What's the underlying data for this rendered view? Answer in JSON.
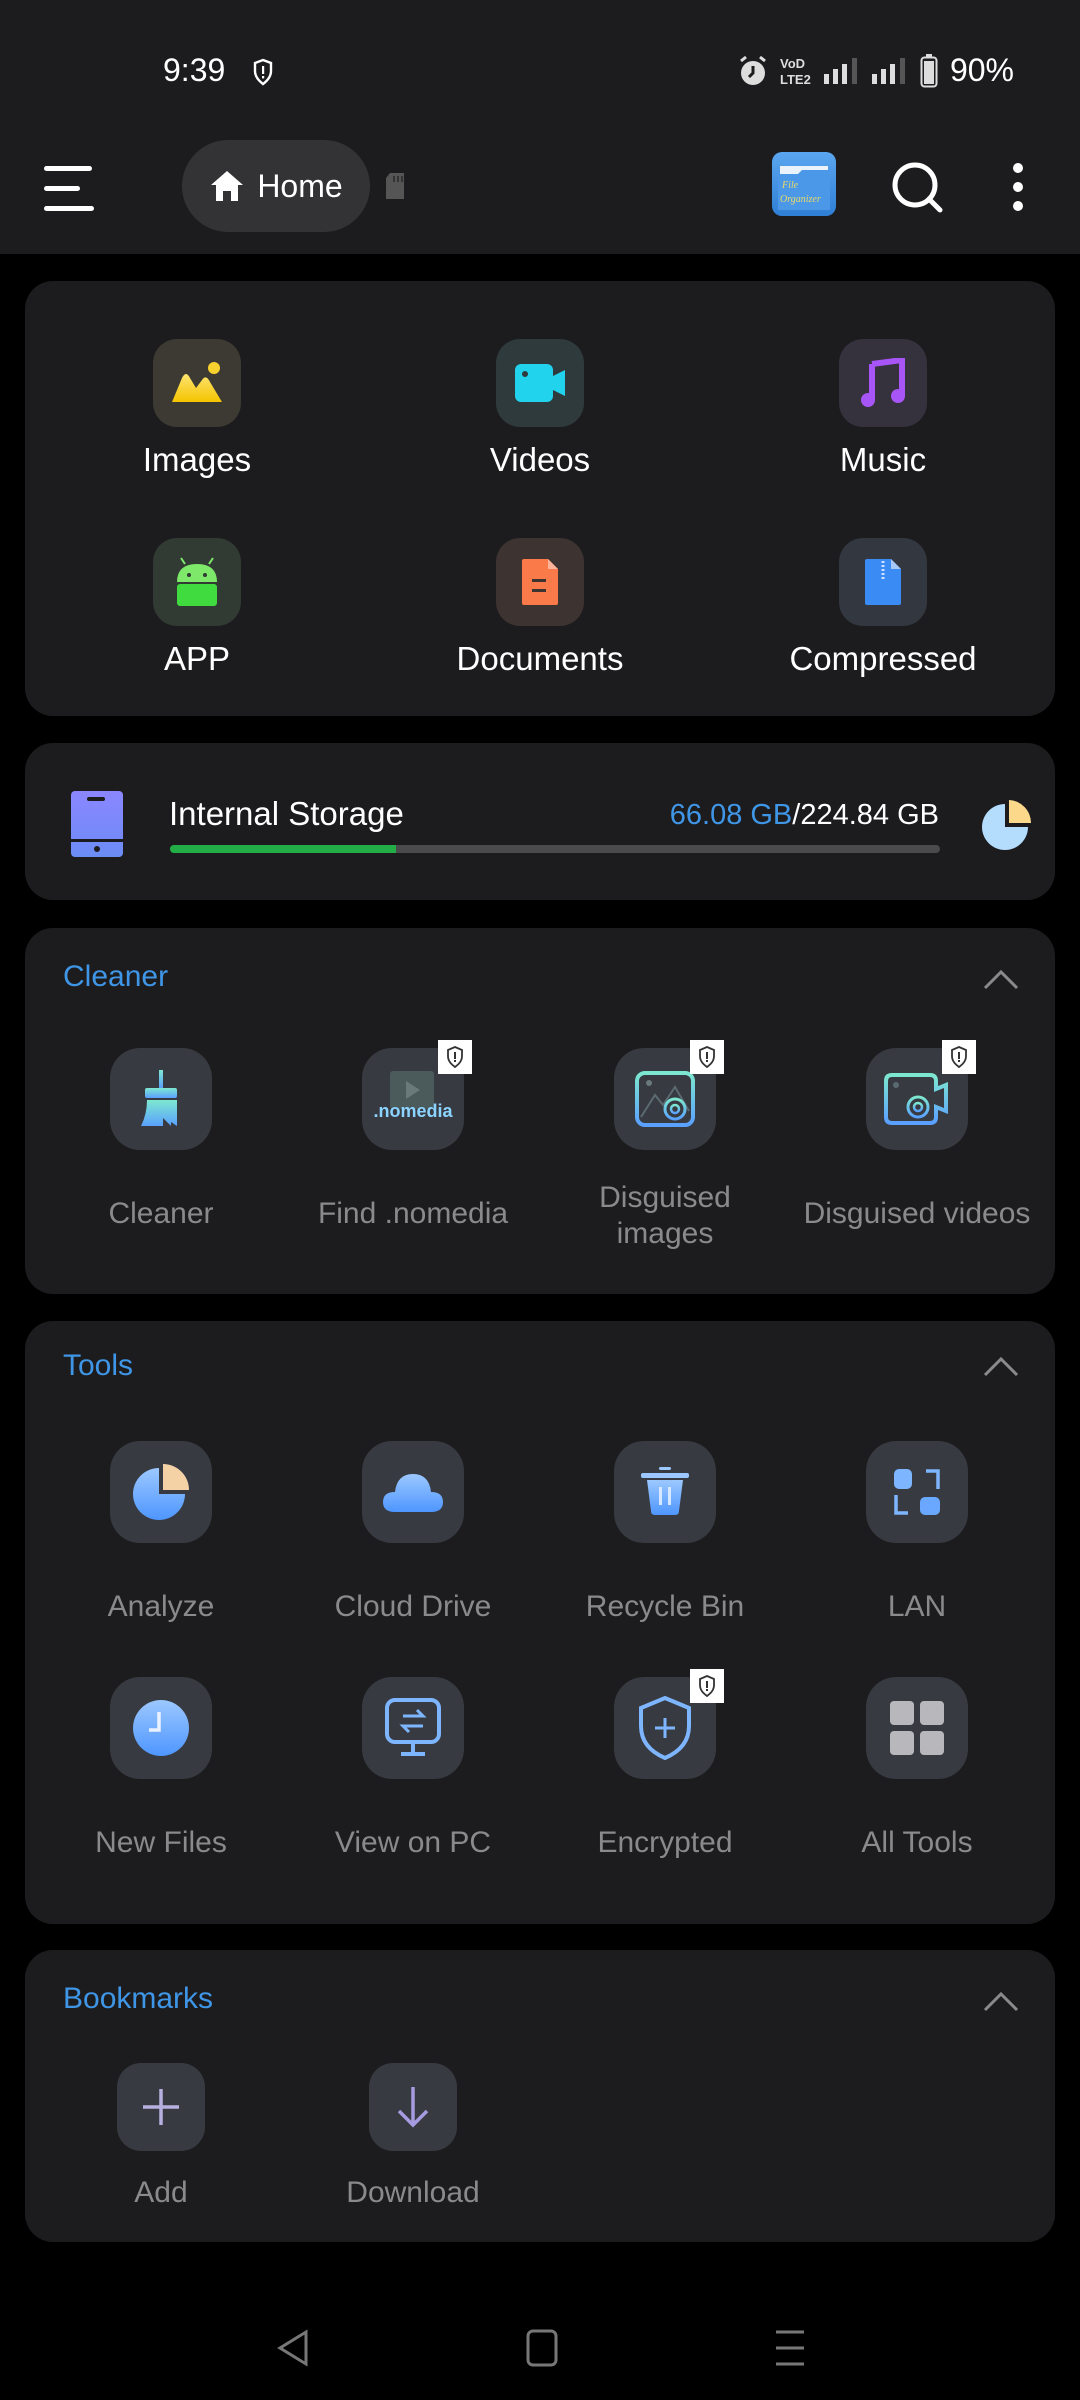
{
  "status_bar": {
    "time": "9:39",
    "battery": "90%",
    "icons": [
      "shield-alert-icon",
      "alarm-icon",
      "volte-icon",
      "signal-icon",
      "signal-icon",
      "battery-icon"
    ]
  },
  "app_bar": {
    "breadcrumb_home": "Home",
    "logo_text_line1": "File",
    "logo_text_line2": "Organizer"
  },
  "categories": [
    {
      "label": "Images",
      "icon": "image-icon",
      "color": "#f7d22e",
      "tile": "#3c3a32"
    },
    {
      "label": "Videos",
      "icon": "video-camera-icon",
      "color": "#22d3ee",
      "tile": "#2f3a3c"
    },
    {
      "label": "Music",
      "icon": "music-note-icon",
      "color": "#a855f7",
      "tile": "#35313d"
    },
    {
      "label": "APP",
      "icon": "android-icon",
      "color": "#4ade5a",
      "tile": "#313a33"
    },
    {
      "label": "Documents",
      "icon": "document-icon",
      "color": "#fb7a4a",
      "tile": "#3d3331"
    },
    {
      "label": "Compressed",
      "icon": "zip-file-icon",
      "color": "#3b8bf5",
      "tile": "#323740"
    }
  ],
  "storage": {
    "title": "Internal Storage",
    "used": "66.08 GB",
    "separator": "/",
    "total": "224.84 GB",
    "used_fraction": 0.294
  },
  "cleaner": {
    "title": "Cleaner",
    "items": [
      {
        "label": "Cleaner",
        "icon": "broom-icon",
        "badge": false
      },
      {
        "label": "Find .nomedia",
        "icon": "nomedia-icon",
        "badge": true,
        "icon_text": ".nomedia"
      },
      {
        "label": "Disguised images",
        "icon": "disguised-image-icon",
        "badge": true
      },
      {
        "label": "Disguised videos",
        "icon": "disguised-video-icon",
        "badge": true
      }
    ]
  },
  "tools": {
    "title": "Tools",
    "items": [
      {
        "label": "Analyze",
        "icon": "pie-chart-icon",
        "badge": false
      },
      {
        "label": "Cloud Drive",
        "icon": "cloud-icon",
        "badge": false
      },
      {
        "label": "Recycle Bin",
        "icon": "trash-icon",
        "badge": false
      },
      {
        "label": "LAN",
        "icon": "lan-icon",
        "badge": false
      },
      {
        "label": "New Files",
        "icon": "clock-icon",
        "badge": false
      },
      {
        "label": "View on PC",
        "icon": "monitor-transfer-icon",
        "badge": false
      },
      {
        "label": "Encrypted",
        "icon": "shield-plus-icon",
        "badge": true
      },
      {
        "label": "All Tools",
        "icon": "grid-icon",
        "badge": false
      }
    ]
  },
  "bookmarks": {
    "title": "Bookmarks",
    "items": [
      {
        "label": "Add",
        "icon": "plus-icon"
      },
      {
        "label": "Download",
        "icon": "download-arrow-icon"
      }
    ]
  },
  "nav_bar": {
    "items": [
      "back-icon",
      "home-square-icon",
      "recents-icon"
    ]
  }
}
